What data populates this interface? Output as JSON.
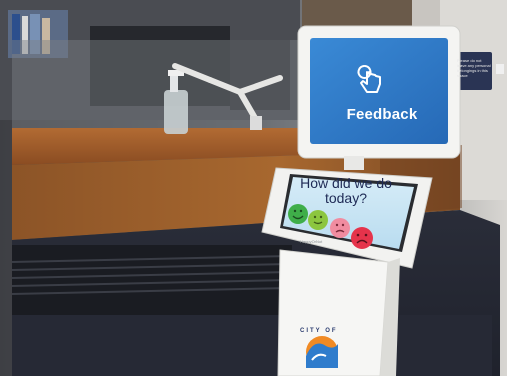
{
  "photo": {
    "description_free": true
  },
  "kiosk": {
    "title": "Feedback",
    "question": "How did we do today?",
    "brand": "HappyOrNot",
    "faces": [
      {
        "name": "very-happy",
        "color": "#3fae49"
      },
      {
        "name": "happy",
        "color": "#8cc63f"
      },
      {
        "name": "unhappy",
        "color": "#f08ca0"
      },
      {
        "name": "very-unhappy",
        "color": "#e5334b"
      }
    ]
  },
  "notice": {
    "text": "Please do not leave any personal belongings in this space"
  },
  "logo": {
    "text": "CITY OF"
  },
  "colors": {
    "screen_blue": "#2f7ccc",
    "kiosk_white": "#f2f2f0",
    "desk_wood": "#9a5a2a",
    "floor": "#2c2f3c"
  }
}
